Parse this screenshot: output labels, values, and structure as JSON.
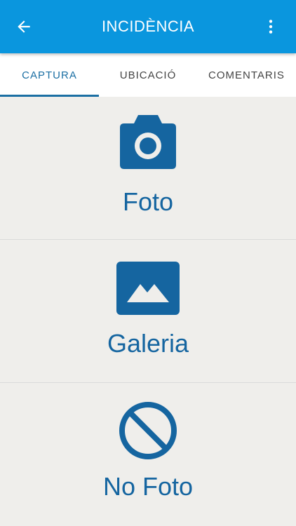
{
  "appbar": {
    "title": "INCIDÈNCIA",
    "back_icon": "arrow-back-icon",
    "menu_icon": "more-vertical-icon",
    "color": "#0a96de"
  },
  "tabs": [
    {
      "label": "CAPTURA",
      "active": true
    },
    {
      "label": "UBICACIÓ",
      "active": false
    },
    {
      "label": "COMENTARIS",
      "active": false
    }
  ],
  "options": [
    {
      "label": "Foto",
      "icon": "camera-icon"
    },
    {
      "label": "Galeria",
      "icon": "image-icon"
    },
    {
      "label": "No Foto",
      "icon": "block-icon"
    }
  ],
  "colors": {
    "accent": "#1b6fa3",
    "icon": "#1565a0",
    "background": "#efeeeb"
  }
}
